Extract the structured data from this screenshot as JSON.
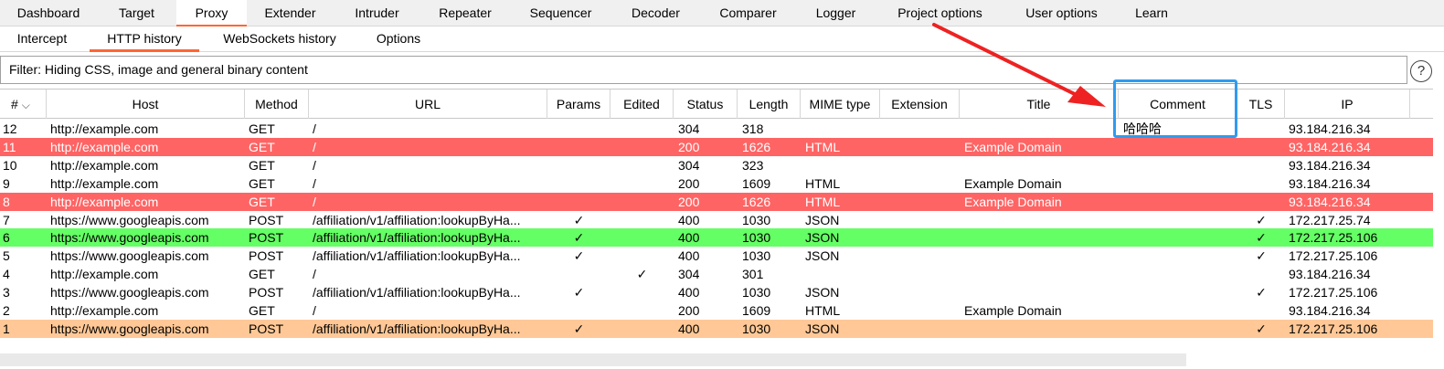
{
  "main_tabs": [
    {
      "label": "Dashboard"
    },
    {
      "label": "Target"
    },
    {
      "label": "Proxy"
    },
    {
      "label": "Extender"
    },
    {
      "label": "Intruder"
    },
    {
      "label": "Repeater"
    },
    {
      "label": "Sequencer"
    },
    {
      "label": "Decoder"
    },
    {
      "label": "Comparer"
    },
    {
      "label": "Logger"
    },
    {
      "label": "Project options"
    },
    {
      "label": "User options"
    },
    {
      "label": "Learn"
    }
  ],
  "active_main_tab": "Proxy",
  "sub_tabs": [
    {
      "label": "Intercept"
    },
    {
      "label": "HTTP history"
    },
    {
      "label": "WebSockets history"
    },
    {
      "label": "Options"
    }
  ],
  "active_sub_tab": "HTTP history",
  "filter": {
    "text": "Filter: Hiding CSS, image and general binary content"
  },
  "help_icon": {
    "glyph": "?"
  },
  "columns": [
    "# ",
    "Host",
    "Method",
    "URL",
    "Params",
    "Edited",
    "Status",
    "Length",
    "MIME type",
    "Extension",
    "Title",
    "Comment",
    "TLS",
    "IP"
  ],
  "sort_icon": "⌵",
  "check_glyph": "✓",
  "row_colors": {
    "red": "#ff6464",
    "green": "#64ff64",
    "orange": "#ffc896"
  },
  "rows": [
    {
      "num": "12",
      "host": "http://example.com",
      "method": "GET",
      "url": "/",
      "params": "",
      "edited": "",
      "status": "304",
      "length": "318",
      "mime": "",
      "ext": "",
      "title": "",
      "comment": "哈哈哈",
      "tls": "",
      "ip": "93.184.216.34",
      "color": ""
    },
    {
      "num": "11",
      "host": "http://example.com",
      "method": "GET",
      "url": "/",
      "params": "",
      "edited": "",
      "status": "200",
      "length": "1626",
      "mime": "HTML",
      "ext": "",
      "title": "Example Domain",
      "comment": "",
      "tls": "",
      "ip": "93.184.216.34",
      "color": "red"
    },
    {
      "num": "10",
      "host": "http://example.com",
      "method": "GET",
      "url": "/",
      "params": "",
      "edited": "",
      "status": "304",
      "length": "323",
      "mime": "",
      "ext": "",
      "title": "",
      "comment": "",
      "tls": "",
      "ip": "93.184.216.34",
      "color": ""
    },
    {
      "num": "9",
      "host": "http://example.com",
      "method": "GET",
      "url": "/",
      "params": "",
      "edited": "",
      "status": "200",
      "length": "1609",
      "mime": "HTML",
      "ext": "",
      "title": "Example Domain",
      "comment": "",
      "tls": "",
      "ip": "93.184.216.34",
      "color": ""
    },
    {
      "num": "8",
      "host": "http://example.com",
      "method": "GET",
      "url": "/",
      "params": "",
      "edited": "",
      "status": "200",
      "length": "1626",
      "mime": "HTML",
      "ext": "",
      "title": "Example Domain",
      "comment": "",
      "tls": "",
      "ip": "93.184.216.34",
      "color": "red"
    },
    {
      "num": "7",
      "host": "https://www.googleapis.com",
      "method": "POST",
      "url": "/affiliation/v1/affiliation:lookupByHa...",
      "params": "✓",
      "edited": "",
      "status": "400",
      "length": "1030",
      "mime": "JSON",
      "ext": "",
      "title": "",
      "comment": "",
      "tls": "✓",
      "ip": "172.217.25.74",
      "color": ""
    },
    {
      "num": "6",
      "host": "https://www.googleapis.com",
      "method": "POST",
      "url": "/affiliation/v1/affiliation:lookupByHa...",
      "params": "✓",
      "edited": "",
      "status": "400",
      "length": "1030",
      "mime": "JSON",
      "ext": "",
      "title": "",
      "comment": "",
      "tls": "✓",
      "ip": "172.217.25.106",
      "color": "green"
    },
    {
      "num": "5",
      "host": "https://www.googleapis.com",
      "method": "POST",
      "url": "/affiliation/v1/affiliation:lookupByHa...",
      "params": "✓",
      "edited": "",
      "status": "400",
      "length": "1030",
      "mime": "JSON",
      "ext": "",
      "title": "",
      "comment": "",
      "tls": "✓",
      "ip": "172.217.25.106",
      "color": ""
    },
    {
      "num": "4",
      "host": "http://example.com",
      "method": "GET",
      "url": "/",
      "params": "",
      "edited": "✓",
      "status": "304",
      "length": "301",
      "mime": "",
      "ext": "",
      "title": "",
      "comment": "",
      "tls": "",
      "ip": "93.184.216.34",
      "color": ""
    },
    {
      "num": "3",
      "host": "https://www.googleapis.com",
      "method": "POST",
      "url": "/affiliation/v1/affiliation:lookupByHa...",
      "params": "✓",
      "edited": "",
      "status": "400",
      "length": "1030",
      "mime": "JSON",
      "ext": "",
      "title": "",
      "comment": "",
      "tls": "✓",
      "ip": "172.217.25.106",
      "color": ""
    },
    {
      "num": "2",
      "host": "http://example.com",
      "method": "GET",
      "url": "/",
      "params": "",
      "edited": "",
      "status": "200",
      "length": "1609",
      "mime": "HTML",
      "ext": "",
      "title": "Example Domain",
      "comment": "",
      "tls": "",
      "ip": "93.184.216.34",
      "color": ""
    },
    {
      "num": "1",
      "host": "https://www.googleapis.com",
      "method": "POST",
      "url": "/affiliation/v1/affiliation:lookupByHa...",
      "params": "✓",
      "edited": "",
      "status": "400",
      "length": "1030",
      "mime": "JSON",
      "ext": "",
      "title": "",
      "comment": "",
      "tls": "✓",
      "ip": "172.217.25.106",
      "color": "orange"
    }
  ],
  "annotation": {
    "arrow_color": "#ee2222",
    "box_color": "#2e9bf0"
  }
}
